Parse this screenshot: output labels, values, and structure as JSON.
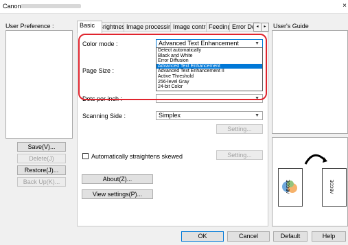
{
  "window": {
    "title": "Canon",
    "close_glyph": "×"
  },
  "left": {
    "user_preference_label": "User Preference :",
    "buttons": {
      "save": "Save(V)...",
      "delete": "Delete(J)",
      "restore": "Restore(J)...",
      "backup": "Back Up(K)..."
    }
  },
  "tabs": [
    {
      "label": "Basic",
      "active": true
    },
    {
      "label": "Brightness"
    },
    {
      "label": "Image processing"
    },
    {
      "label": "Image control"
    },
    {
      "label": "Feeding"
    },
    {
      "label": "Error De"
    }
  ],
  "tab_scroll": {
    "left": "◂",
    "right": "▸"
  },
  "basic": {
    "color_mode_label": "Color mode :",
    "color_mode_value": "Advanced Text Enhancement",
    "color_mode_options": [
      "Detect automatically",
      "Black and White",
      "Error Diffusion",
      "Advanced Text Enhancement",
      "Advanced Text Enhancement II",
      "Active Threshold",
      "256-level Gray",
      "24-bit Color"
    ],
    "color_mode_selected_index": 3,
    "page_size_label": "Page Size :",
    "dots_per_inch_label": "Dots per inch :",
    "scanning_side_label": "Scanning Side :",
    "scanning_side_value": "Simplex",
    "setting_button": "Setting...",
    "straighten_label": "Automatically straightens skewed",
    "straighten_setting_button": "Setting...",
    "about_button": "About(Z)...",
    "view_settings_button": "View settings(P)..."
  },
  "right": {
    "users_guide_label": "User's Guide",
    "preview_page_text": "ABCDE"
  },
  "footer": {
    "ok": "OK",
    "cancel": "Cancel",
    "default": "Default",
    "help": "Help"
  },
  "colors": {
    "accent": "#0078d7",
    "highlight": "#e0242d"
  }
}
